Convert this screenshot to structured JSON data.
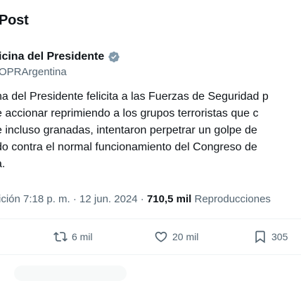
{
  "header": {
    "title": "Post"
  },
  "author": {
    "name": "icina del Presidente",
    "handle": "OPRArgentina",
    "verified_icon": "verified-badge-icon"
  },
  "tweet": {
    "lines": [
      "na del Presidente felicita a las Fuerzas de Seguridad p",
      "e accionar reprimiendo a los grupos terroristas que c",
      "e incluso granadas, intentaron perpetrar un golpe de",
      "do contra el normal funcionamiento del Congreso de",
      "a."
    ]
  },
  "meta": {
    "time_prefix": "ición 7:18 p. m. · 12 jun. 2024 · ",
    "views_count": "710,5 mil",
    "views_label": " Reproducciones"
  },
  "actions": {
    "retweets": "6 mil",
    "likes": "20 mil",
    "bookmarks": "305"
  },
  "colors": {
    "text": "#0f1419",
    "secondary": "#536471",
    "verified": "#829aab",
    "divider": "#eff3f4"
  }
}
